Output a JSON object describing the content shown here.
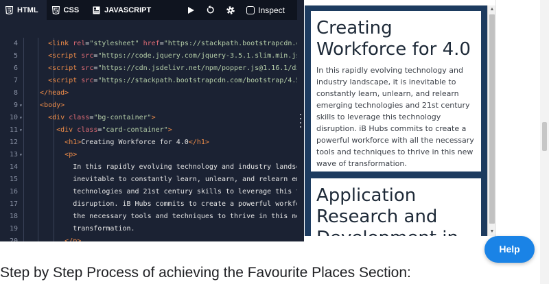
{
  "toolbar": {
    "tabs": [
      {
        "label": "HTML",
        "icon": "html5-icon"
      },
      {
        "label": "CSS",
        "icon": "css3-icon"
      },
      {
        "label": "JAVASCRIPT",
        "icon": "javascript-icon"
      }
    ],
    "inspect_label": "Inspect"
  },
  "code_lines": [
    {
      "n": "4",
      "fold": "",
      "parts": [
        [
          "pl",
          "    "
        ],
        [
          "tg",
          "<link"
        ],
        [
          "pl",
          " "
        ],
        [
          "at",
          "rel"
        ],
        [
          "pl",
          "="
        ],
        [
          "st",
          "\"stylesheet\""
        ],
        [
          "pl",
          " "
        ],
        [
          "at",
          "href"
        ],
        [
          "pl",
          "="
        ],
        [
          "st",
          "\"https://stackpath.bootstrapcdn.com/boo"
        ]
      ]
    },
    {
      "n": "5",
      "fold": "",
      "parts": [
        [
          "pl",
          "    "
        ],
        [
          "tg",
          "<script"
        ],
        [
          "pl",
          " "
        ],
        [
          "at",
          "src"
        ],
        [
          "pl",
          "="
        ],
        [
          "st",
          "\"https://code.jquery.com/jquery-3.5.1.slim.min.js\""
        ],
        [
          "pl",
          " "
        ],
        [
          "at",
          "inte"
        ]
      ]
    },
    {
      "n": "6",
      "fold": "",
      "parts": [
        [
          "pl",
          "    "
        ],
        [
          "tg",
          "<script"
        ],
        [
          "pl",
          " "
        ],
        [
          "at",
          "src"
        ],
        [
          "pl",
          "="
        ],
        [
          "st",
          "\"https://cdn.jsdelivr.net/npm/popper.js@1.16.1/dist/umd"
        ]
      ]
    },
    {
      "n": "7",
      "fold": "",
      "parts": [
        [
          "pl",
          "    "
        ],
        [
          "tg",
          "<script"
        ],
        [
          "pl",
          " "
        ],
        [
          "at",
          "src"
        ],
        [
          "pl",
          "="
        ],
        [
          "st",
          "\"https://stackpath.bootstrapcdn.com/bootstrap/4.5.2/js/"
        ]
      ]
    },
    {
      "n": "8",
      "fold": "",
      "parts": [
        [
          "pl",
          "  "
        ],
        [
          "tg",
          "</head>"
        ]
      ]
    },
    {
      "n": "9",
      "fold": "▾",
      "parts": [
        [
          "pl",
          "  "
        ],
        [
          "tg",
          "<body>"
        ]
      ]
    },
    {
      "n": "10",
      "fold": "▾",
      "parts": [
        [
          "pl",
          "    "
        ],
        [
          "tg",
          "<div"
        ],
        [
          "pl",
          " "
        ],
        [
          "at",
          "class"
        ],
        [
          "pl",
          "="
        ],
        [
          "st",
          "\"bg-container\""
        ],
        [
          "tg",
          ">"
        ]
      ]
    },
    {
      "n": "11",
      "fold": "▾",
      "parts": [
        [
          "pl",
          "      "
        ],
        [
          "tg",
          "<div"
        ],
        [
          "pl",
          " "
        ],
        [
          "at",
          "class"
        ],
        [
          "pl",
          "="
        ],
        [
          "st",
          "\"card-container\""
        ],
        [
          "tg",
          ">"
        ]
      ]
    },
    {
      "n": "12",
      "fold": "",
      "parts": [
        [
          "pl",
          "        "
        ],
        [
          "tg",
          "<h1>"
        ],
        [
          "pl",
          "Creating Workforce for 4.0"
        ],
        [
          "tg",
          "</h1>"
        ]
      ]
    },
    {
      "n": "13",
      "fold": "▾",
      "parts": [
        [
          "pl",
          "        "
        ],
        [
          "tg",
          "<p>"
        ]
      ]
    },
    {
      "n": "14",
      "fold": "",
      "parts": [
        [
          "pl",
          "          In this rapidly evolving technology and industry landscape, i"
        ]
      ]
    },
    {
      "n": "15",
      "fold": "",
      "parts": [
        [
          "pl",
          "          inevitable to constantly learn, unlearn, and relearn emerging"
        ]
      ]
    },
    {
      "n": "16",
      "fold": "",
      "parts": [
        [
          "pl",
          "          technologies and 21st century skills to leverage this technol"
        ]
      ]
    },
    {
      "n": "17",
      "fold": "",
      "parts": [
        [
          "pl",
          "          disruption. iB Hubs commits to create a powerful workforce wi"
        ]
      ]
    },
    {
      "n": "18",
      "fold": "",
      "parts": [
        [
          "pl",
          "          the necessary tools and techniques to thrive in this new wave"
        ]
      ]
    },
    {
      "n": "19",
      "fold": "",
      "parts": [
        [
          "pl",
          "          transformation."
        ]
      ]
    },
    {
      "n": "20",
      "fold": "",
      "parts": [
        [
          "pl",
          "        "
        ],
        [
          "tg",
          "</p>"
        ]
      ]
    }
  ],
  "preview": {
    "card1": {
      "title": "Creating Workforce for 4.0",
      "body": "In this rapidly evolving technology and industry landscape, it is inevitable to constantly learn, unlearn, and relearn emerging technologies and 21st century skills to leverage this technology disruption. iB Hubs commits to create a powerful workforce with all the necessary tools and techniques to thrive in this new wave of transformation."
    },
    "card2": {
      "title": "Application Research and Development in"
    },
    "colors": {
      "background": "#1d3b5f"
    }
  },
  "help_label": "Help",
  "section_heading": "Step by Step Process of achieving the Favourite Places Section:"
}
